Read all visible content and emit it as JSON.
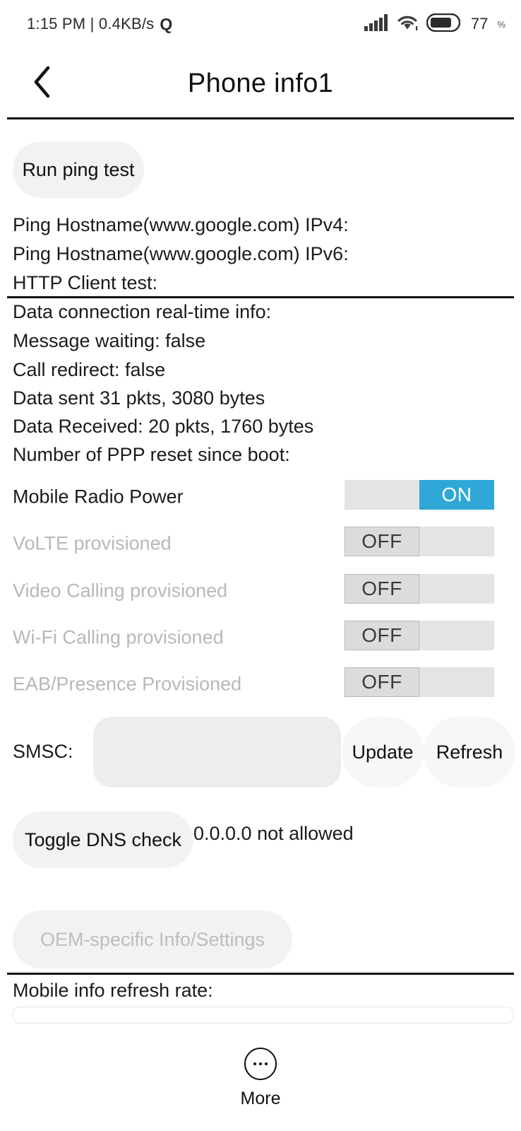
{
  "status_bar": {
    "time": "1:15 PM",
    "separator": "|",
    "network_speed": "0.4KB/s",
    "quiet_icon_label": "Q",
    "signal_icon": "signal-bars-icon",
    "wifi_icon": "wifi-icon",
    "battery_icon": "battery-icon",
    "battery_percent": "77",
    "battery_symbol": "%"
  },
  "header": {
    "back_icon": "chevron-left-icon",
    "title": "Phone info1"
  },
  "ping": {
    "run_button_label": "Run ping test",
    "lines": [
      "Ping Hostname(www.google.com) IPv4:",
      "Ping Hostname(www.google.com) IPv6:",
      "HTTP Client test:"
    ]
  },
  "data_connection": {
    "lines": [
      "Data connection real-time info:",
      "Message waiting: false",
      "Call redirect: false",
      "Data sent 31 pkts, 3080 bytes",
      "Data Received: 20 pkts, 1760 bytes",
      "Number of PPP reset since boot:"
    ]
  },
  "toggles": [
    {
      "label": "Mobile Radio Power",
      "state": "ON",
      "enabled": true
    },
    {
      "label": "VoLTE provisioned",
      "state": "OFF",
      "enabled": false
    },
    {
      "label": "Video Calling provisioned",
      "state": "OFF",
      "enabled": false
    },
    {
      "label": "Wi-Fi Calling provisioned",
      "state": "OFF",
      "enabled": false
    },
    {
      "label": "EAB/Presence Provisioned",
      "state": "OFF",
      "enabled": false
    }
  ],
  "smsc": {
    "label": "SMSC:",
    "value": "",
    "placeholder": "",
    "update_label": "Update",
    "refresh_label": "Refresh"
  },
  "dns": {
    "toggle_label": "Toggle DNS check",
    "status": "0.0.0.0 not allowed"
  },
  "oem": {
    "label": "OEM-specific Info/Settings",
    "enabled": false
  },
  "refresh_rate": {
    "label": "Mobile info refresh rate:"
  },
  "bottom_nav": {
    "more_icon": "more-dots-icon",
    "more_label": "More"
  },
  "colors": {
    "accent_on": "#2fa8d8",
    "track": "#e4e4e4",
    "thumb_off": "#dcdcdc",
    "button_bg": "#f2f2f2",
    "disabled_text": "#b8b8b8",
    "text": "#1b1b1b"
  }
}
